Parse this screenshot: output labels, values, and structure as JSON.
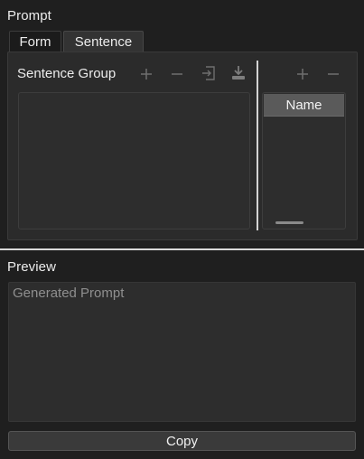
{
  "prompt": {
    "label": "Prompt",
    "tabs": [
      {
        "label": "Form",
        "selected": false
      },
      {
        "label": "Sentence",
        "selected": true
      }
    ],
    "sentence_group": {
      "title": "Sentence Group",
      "toolbar": [
        {
          "name": "add-icon"
        },
        {
          "name": "remove-icon"
        },
        {
          "name": "import-icon"
        },
        {
          "name": "download-icon"
        }
      ]
    },
    "name_table": {
      "toolbar": [
        {
          "name": "add-icon"
        },
        {
          "name": "remove-icon"
        }
      ],
      "header": "Name"
    }
  },
  "preview": {
    "label": "Preview",
    "placeholder": "Generated Prompt"
  },
  "copy_button": {
    "label": "Copy"
  },
  "colors": {
    "background": "#1f1f1f",
    "panel": "#2b2b2b",
    "header": "#5a5a5a",
    "text": "#ececec",
    "placeholder": "#8f8f8f",
    "icon": "#7a7a7a"
  }
}
